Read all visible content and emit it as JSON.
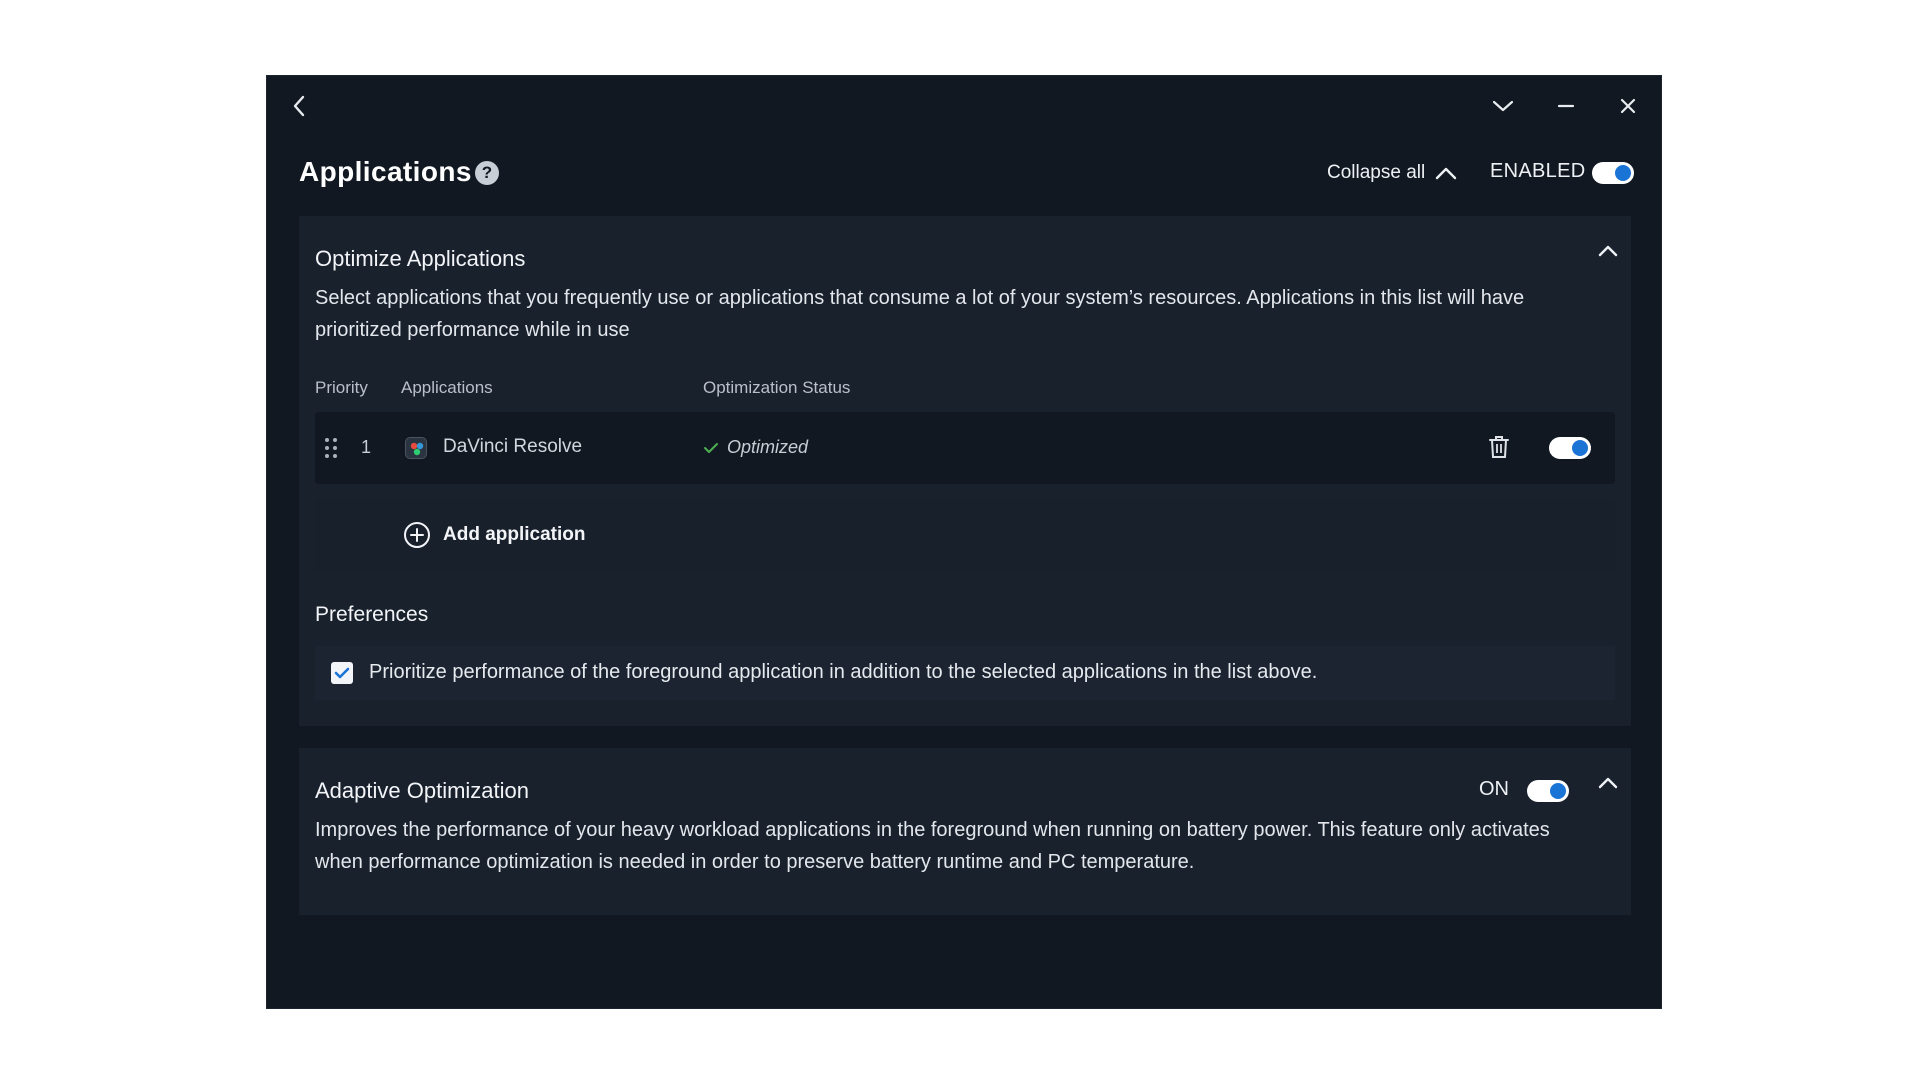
{
  "header": {
    "title": "Applications",
    "help_glyph": "?",
    "collapse_all_label": "Collapse all",
    "enabled_label": "ENABLED",
    "enabled": true
  },
  "optimize": {
    "title": "Optimize Applications",
    "description": "Select applications that you frequently use or applications that consume a lot of your system’s resources. Applications in this list will have prioritized performance while in use",
    "columns": {
      "priority": "Priority",
      "applications": "Applications",
      "status": "Optimization Status"
    },
    "apps": [
      {
        "priority": "1",
        "name": "DaVinci Resolve",
        "status": "Optimized",
        "enabled": true
      }
    ],
    "add_label": "Add application"
  },
  "preferences": {
    "title": "Preferences",
    "option_label": "Prioritize performance of the foreground application in addition to the selected applications in the list above.",
    "option_checked": true
  },
  "adaptive": {
    "title": "Adaptive Optimization",
    "state_label": "ON",
    "enabled": true,
    "description": "Improves the performance of your heavy workload applications in the foreground when running on battery power. This feature only activates when performance optimization is needed in order to preserve battery runtime and PC temperature."
  },
  "colors": {
    "window_bg": "#111821",
    "panel_bg": "#19212d",
    "accent": "#1a74d6",
    "success": "#4caf50"
  }
}
